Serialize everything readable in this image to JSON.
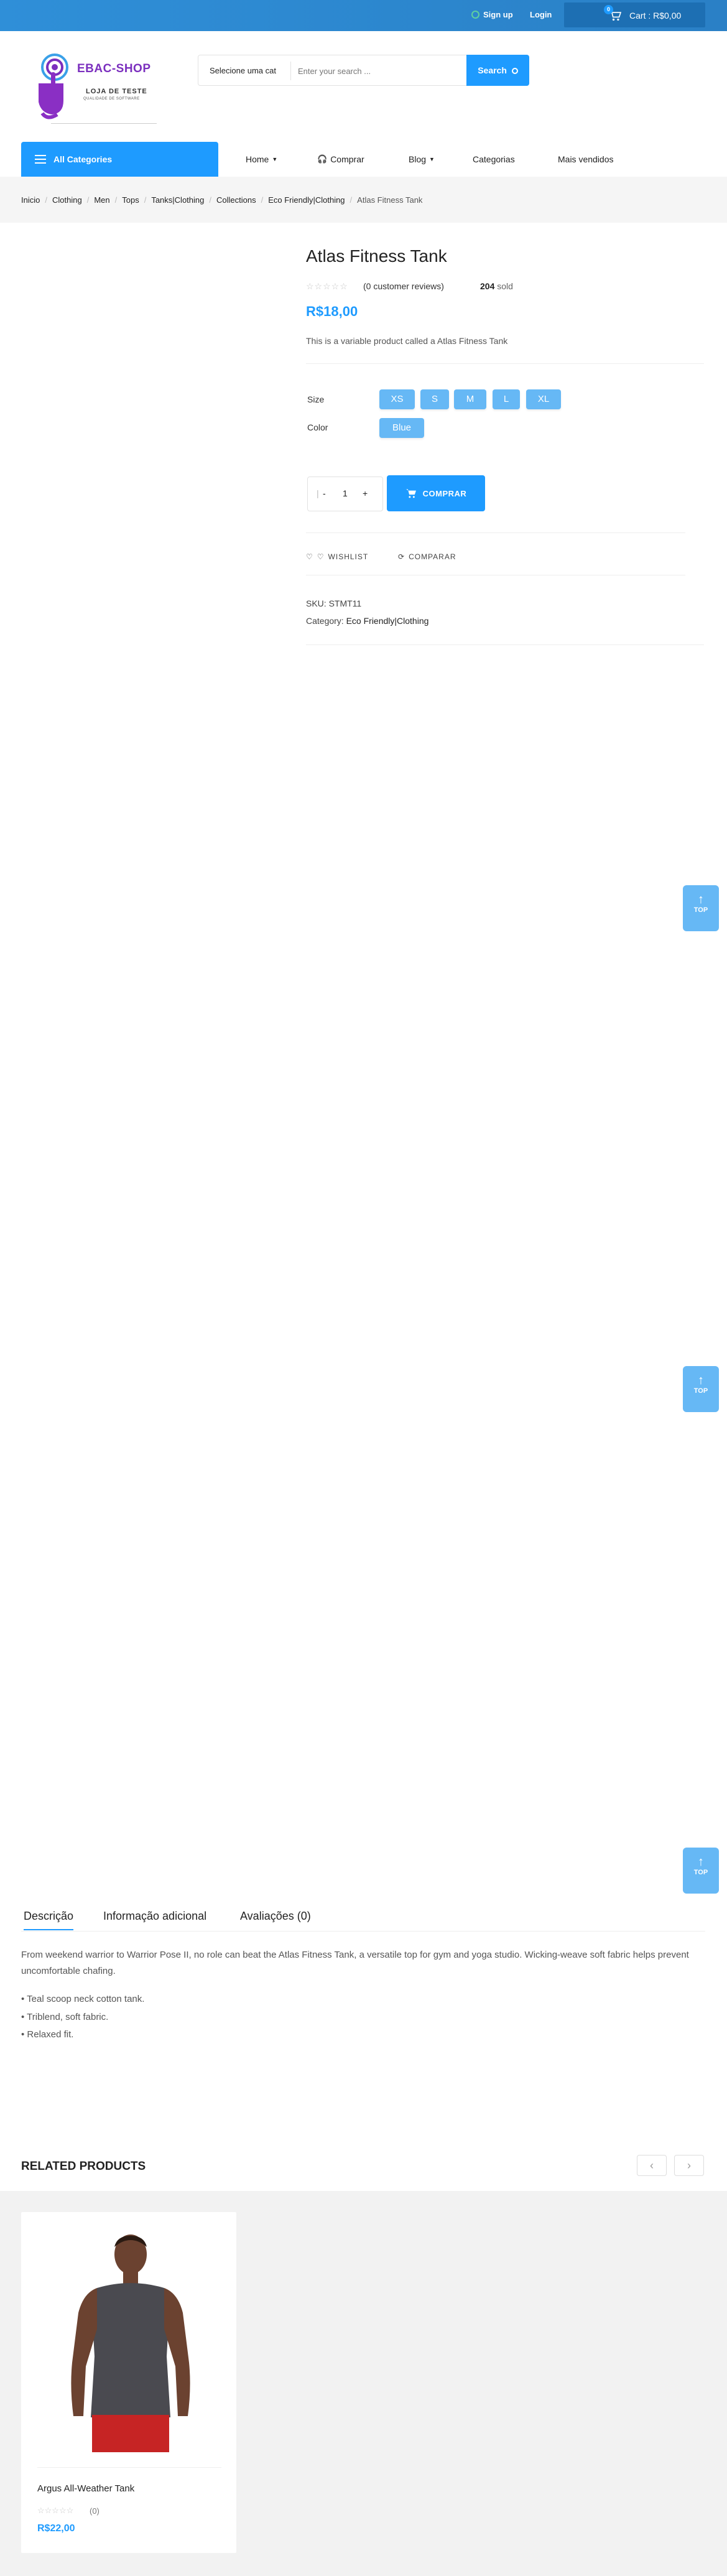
{
  "topbar": {
    "signup": "Sign up",
    "login": "Login",
    "wishlist_count": "0",
    "cart_count": "0",
    "cart_label": "Cart : R$0,00"
  },
  "logo": {
    "title": "EBAC-SHOP",
    "subtitle": "LOJA DE TESTE",
    "tagline": "QUALIDADE DE SOFTWARE"
  },
  "search": {
    "category": "Selecione uma cat",
    "placeholder": "Enter your search ...",
    "button": "Search"
  },
  "nav": {
    "all_categories": "All Categories",
    "items": [
      "Home",
      "Comprar",
      "Blog",
      "Categorias",
      "Mais vendidos"
    ]
  },
  "breadcrumb": [
    "Inicio",
    "Clothing",
    "Men",
    "Tops",
    "Tanks|Clothing",
    "Collections",
    "Eco Friendly|Clothing",
    "Atlas Fitness Tank"
  ],
  "product": {
    "title": "Atlas Fitness Tank",
    "reviews": "(0 customer reviews)",
    "sold_count": "204",
    "sold_label": "sold",
    "price": "R$18,00",
    "description": "This is a variable product called a Atlas Fitness Tank",
    "size_label": "Size",
    "sizes": [
      "XS",
      "S",
      "M",
      "L",
      "XL"
    ],
    "color_label": "Color",
    "colors": [
      "Blue"
    ],
    "qty_minus": "-",
    "qty_value": "1",
    "qty_plus": "+",
    "buy_button": "COMPRAR",
    "wishlist": "WISHLIST",
    "compare": "COMPARAR",
    "sku": "SKU: STMT11",
    "category_label": "Category:",
    "category_value": "Eco Friendly|Clothing"
  },
  "top_button": "TOP",
  "tabs": {
    "items": [
      "Descrição",
      "Informação adicional",
      "Avaliações (0)"
    ],
    "active_index": 0,
    "description": "From weekend warrior to Warrior Pose II, no role can beat the Atlas Fitness Tank, a versatile top for gym and yoga studio. Wicking-weave soft fabric helps prevent uncomfortable chafing.",
    "bullets": [
      "• Teal scoop neck cotton tank.",
      "• Triblend, soft fabric.",
      "• Relaxed fit."
    ]
  },
  "related": {
    "title": "RELATED PRODUCTS",
    "prev": "‹",
    "next": "›",
    "products": [
      {
        "name": "Argus All-Weather Tank",
        "reviews": "(0)",
        "price": "R$22,00"
      }
    ]
  },
  "colors": {
    "brand_blue": "#1e9bff",
    "chip_blue": "#66b8f5",
    "logo_purple": "#7b2fbe"
  }
}
